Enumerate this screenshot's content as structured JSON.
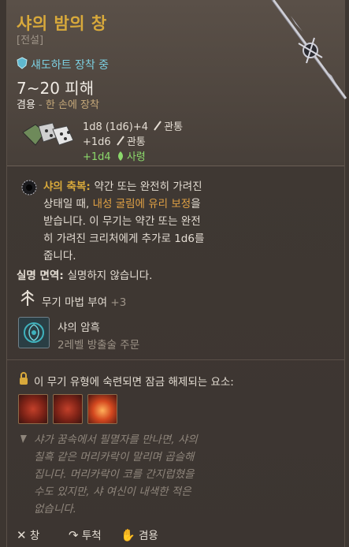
{
  "item": {
    "name": "샤의 밤의 창",
    "rarity": "[전설]",
    "equipped": "섀도하트 장착 중",
    "damage": "7~20 피해",
    "handedness_label": "겸용",
    "handedness_sep": " - ",
    "handedness_value": "한 손에 장착",
    "damage_lines": [
      {
        "text": "1d8 (1d6)+4",
        "type": "관통"
      },
      {
        "text": "+1d6",
        "type": "관통"
      },
      {
        "text": "+1d4",
        "type": "사령"
      }
    ]
  },
  "passive": {
    "name": "샤의 축복",
    "sep": ": ",
    "line1_rest": "약간 또는 완전히 가려진",
    "line2_pre": "상태일 때, ",
    "line2_hl": "내성 굴림에 유리 보정",
    "line2_post": "을",
    "line3": "받습니다. 이 무기는 약간 또는 완전",
    "line4": "히 가려진 크리처에게 추가로 1d6를",
    "line5": "줍니다."
  },
  "immunity": {
    "label": "실명 면역",
    "sep": ": ",
    "text": "실명하지 않습니다."
  },
  "enchant": {
    "label": "무기 마법 부여",
    "value": "+3"
  },
  "spell": {
    "name": "샤의 암흑",
    "desc": "2레벨 방출술 주문"
  },
  "mastery": {
    "title": "이 무기 유형에 숙련되면 잠금 해제되는 요소:"
  },
  "flavor": {
    "lines": [
      "샤가 꿈속에서 필멸자를 만나면, 샤의",
      "칠흑 같은 머리카락이 말리며 곱슬해",
      "집니다. 머리카락이 코를 간지럽혔을",
      "수도 있지만, 샤 여신이 내색한 적은",
      "없습니다."
    ]
  },
  "footer": {
    "weapon_type": "창",
    "property1": "투척",
    "property2": "겸용"
  },
  "colors": {
    "title": "#d8a93b",
    "equipped": "#7ccfe0",
    "necrotic": "#8bd86b"
  }
}
